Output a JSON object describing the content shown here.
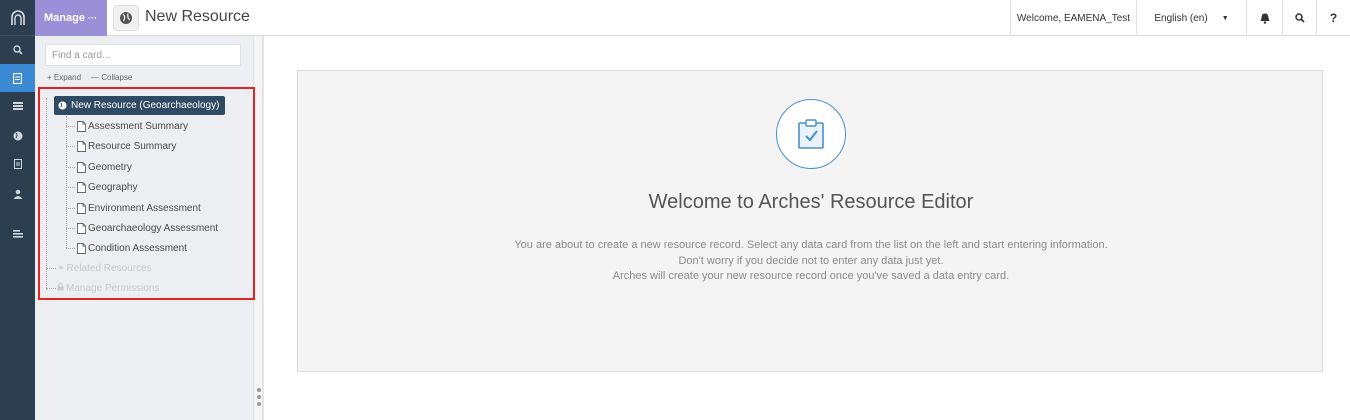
{
  "header": {
    "manage_label": "Manage",
    "manage_dots": "···",
    "page_title": "New Resource",
    "welcome_user": "Welcome, EAMENA_Test",
    "language": "English (en)",
    "help_label": "?"
  },
  "rail": {
    "icons": [
      "search-icon",
      "resource-editor-icon",
      "list-icon",
      "globe-icon",
      "reports-icon",
      "user-icon",
      "menu-icon"
    ],
    "active_index": 1
  },
  "sidebar": {
    "search_placeholder": "Find a card...",
    "expand_label": "+ Expand",
    "collapse_label": "— Collapse",
    "root": "New Resource (Geoarchaeology)",
    "cards": [
      "Assessment Summary",
      "Resource Summary",
      "Geometry",
      "Geography",
      "Environment Assessment",
      "Geoarchaeology Assessment",
      "Condition Assessment"
    ],
    "extra_nodes": [
      "Related Resources",
      "Manage Permissions"
    ]
  },
  "main": {
    "welcome_title": "Welcome to Arches' Resource Editor",
    "lines": [
      "You are about to create a new resource record. Select any data card from the list on the left and start entering information.",
      "Don't worry if you decide not to enter any data just yet.",
      "Arches will create your new resource record once you've saved a data entry card."
    ]
  },
  "colors": {
    "rail": "#2c3e50",
    "rail_active": "#3a8bd4",
    "manage": "#9b8fd8",
    "tree_root": "#2f4a63",
    "highlight": "#e02424"
  }
}
